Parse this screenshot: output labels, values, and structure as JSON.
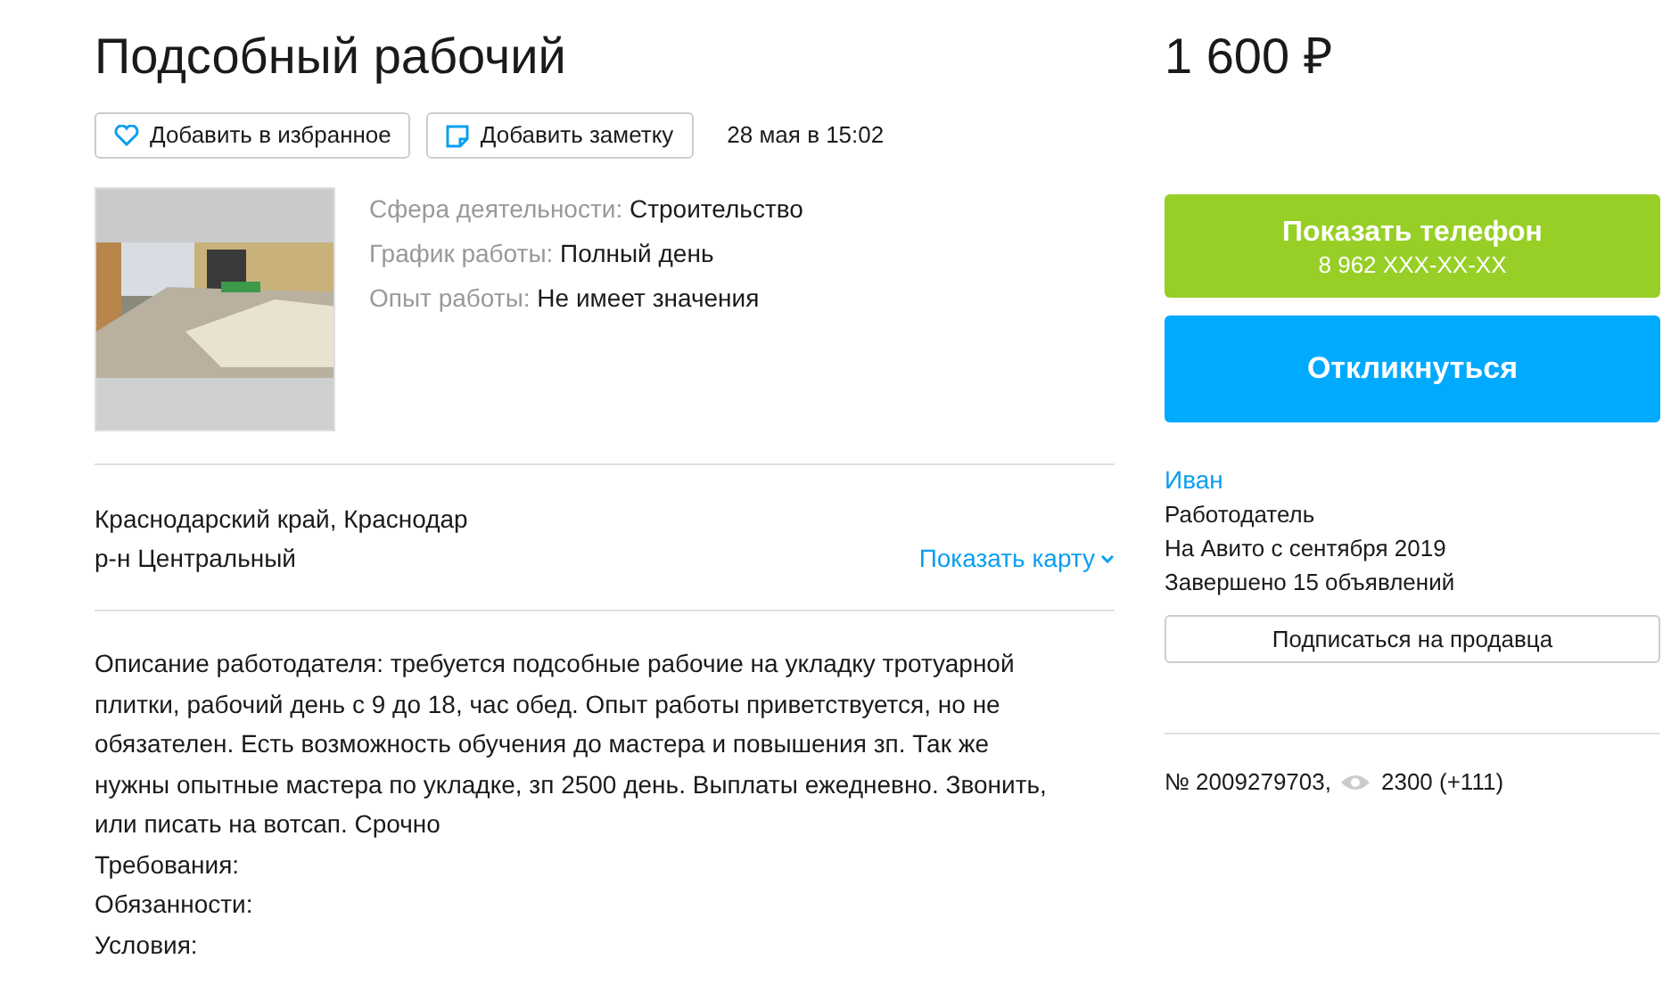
{
  "title": "Подсобный рабочий",
  "price": "1 600 ₽",
  "actions": [
    {
      "kind": "favorite",
      "label": "Добавить в избранное"
    },
    {
      "kind": "note",
      "label": "Добавить заметку"
    }
  ],
  "date": "28 мая в 15:02",
  "params": [
    {
      "label": "Сфера деятельности:",
      "value": "Строительство"
    },
    {
      "label": "График работы:",
      "value": "Полный день"
    },
    {
      "label": "Опыт работы:",
      "value": "Не имеет значения"
    }
  ],
  "address": {
    "lines": [
      "Краснодарский край, Краснодар",
      "р-н Центральный"
    ],
    "map_link": "Показать карту"
  },
  "description": [
    "Описание работодателя: требуется подсобные рабочие на укладку тротуарной плитки, рабочий день с 9 до 18, час обед. Опыт работы приветствуется, но не обязателен. Есть возможность обучения до мастера и повышения зп. Так же нужны опытные мастера по укладке, зп 2500 день. Выплаты ежедневно. Звонить, или писать на вотсап. Срочно",
    "Требования:",
    "Обязанности:",
    "Условия:"
  ],
  "phone_button": {
    "label": "Показать телефон",
    "phone": "8 962 XXX-XX-XX"
  },
  "respond_button": "Откликнуться",
  "seller": {
    "name": "Иван",
    "role": "Работодатель",
    "since": "На Авито с сентября 2019",
    "completed": "Завершено 15 объявлений"
  },
  "subscribe_button": "Подписаться на продавца",
  "ad_number": "№ 2009279703,",
  "views": "2300 (+111)"
}
